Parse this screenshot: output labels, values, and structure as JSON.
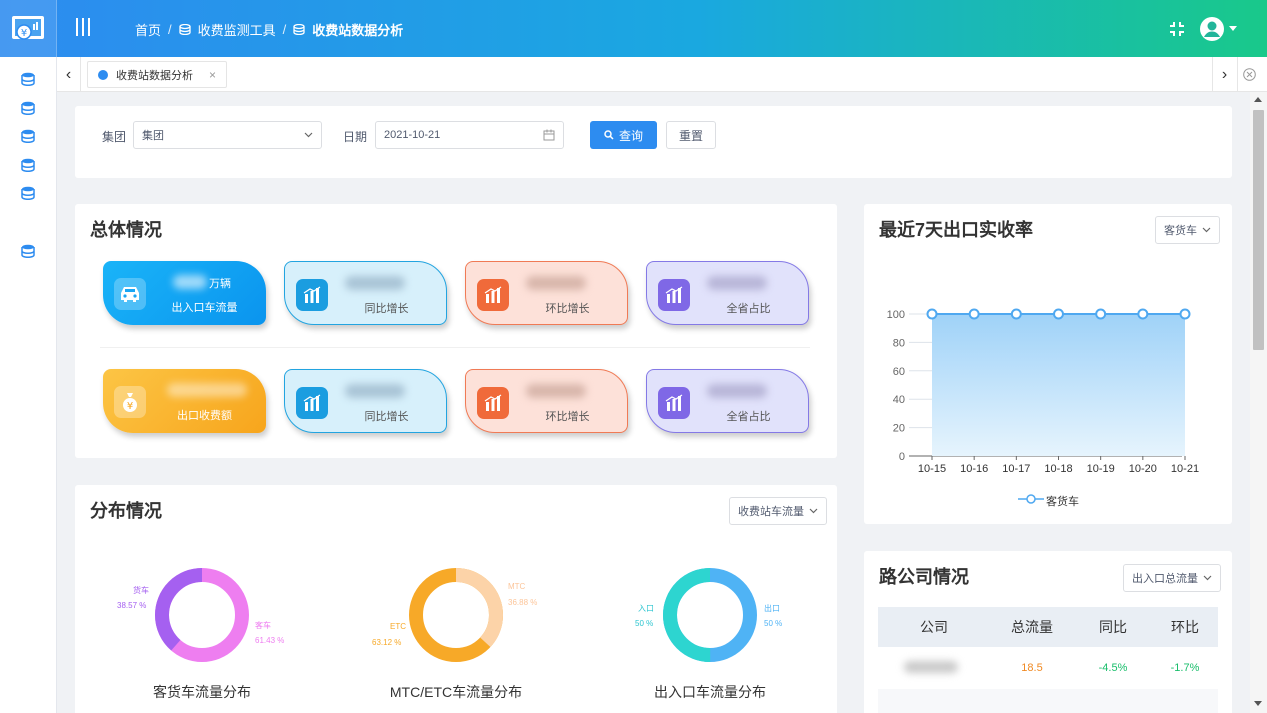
{
  "header": {
    "breadcrumb": [
      "首页",
      "收费监测工具",
      "收费站数据分析"
    ],
    "separator": "/"
  },
  "tabs": {
    "active_label": "收费站数据分析",
    "close_glyph": "×"
  },
  "filter": {
    "group_label": "集团",
    "group_value": "集团",
    "date_label": "日期",
    "date_value": "2021-10-21",
    "query_label": "查询",
    "reset_label": "重置"
  },
  "overview": {
    "title": "总体情况",
    "traffic_unit": "万辆",
    "traffic_caption": "出入口车流量",
    "revenue_caption": "出口收费额",
    "yoy_caption": "同比增长",
    "mom_caption": "环比增长",
    "share_caption": "全省占比"
  },
  "distribution": {
    "title": "分布情况",
    "selector": "收费站车流量",
    "charts": [
      {
        "title": "客货车流量分布",
        "labels": [
          {
            "name": "货车",
            "pct": "38.57 %",
            "value": 38.57,
            "color": "#a560f0"
          },
          {
            "name": "客车",
            "pct": "61.43 %",
            "value": 61.43,
            "color": "#ee7ef0"
          }
        ]
      },
      {
        "title": "MTC/ETC车流量分布",
        "labels": [
          {
            "name": "MTC",
            "pct": "36.88 %",
            "value": 36.88,
            "color": "#fcd3a8"
          },
          {
            "name": "ETC",
            "pct": "63.12 %",
            "value": 63.12,
            "color": "#f7a928"
          }
        ]
      },
      {
        "title": "出入口车流量分布",
        "labels": [
          {
            "name": "入口",
            "pct": "50 %",
            "value": 50,
            "color": "#2dd5d0"
          },
          {
            "name": "出口",
            "pct": "50 %",
            "value": 50,
            "color": "#4fb3f5"
          }
        ]
      }
    ]
  },
  "rate": {
    "title": "最近7天出口实收率",
    "selector": "客货车",
    "legend": "客货车"
  },
  "chart_data": {
    "type": "area",
    "title": "最近7天出口实收率",
    "categories": [
      "10-15",
      "10-16",
      "10-17",
      "10-18",
      "10-19",
      "10-20",
      "10-21"
    ],
    "series": [
      {
        "name": "客货车",
        "values": [
          100,
          100,
          100,
          100,
          100,
          100,
          100
        ]
      }
    ],
    "ylim": [
      0,
      100
    ],
    "yticks": [
      0,
      20,
      40,
      60,
      80,
      100
    ],
    "grid": true,
    "legend": "bottom",
    "color": "#4fa8f0"
  },
  "road": {
    "title": "路公司情况",
    "selector": "出入口总流量",
    "headers": [
      "公司",
      "总流量",
      "同比",
      "环比"
    ],
    "row": {
      "total": "18.5",
      "yoy": "-4.5%",
      "mom": "-1.7%"
    }
  },
  "colors": {
    "accent": "#2d8cf0",
    "up_green": "#19be6b",
    "orange": "#f08a24"
  }
}
